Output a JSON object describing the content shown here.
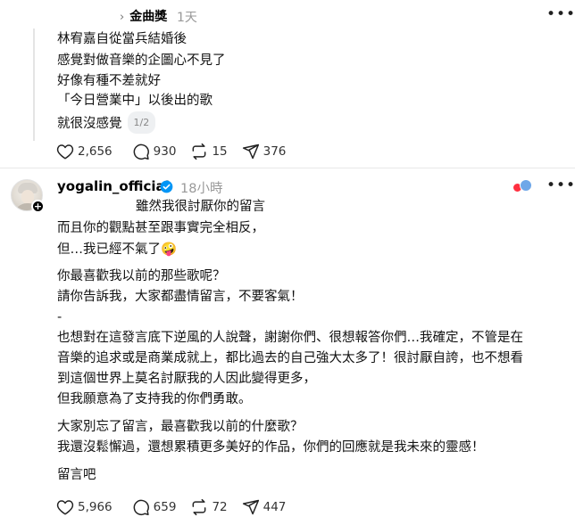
{
  "top_post": {
    "author": "金曲獎",
    "time": "1天",
    "lines": [
      "林宥嘉自從當兵結婚後",
      "感覺對做音樂的企圖心不見了",
      "好像有種不差就好",
      "「今日營業中」以後出的歌",
      "就很沒感覺"
    ],
    "pager": "1/2",
    "likes": "2,656",
    "comments": "930",
    "reposts": "15",
    "shares": "376"
  },
  "main_post": {
    "username": "yogalin_official",
    "time": "18小時",
    "lines": [
      "雖然我很討厭你的留言",
      "而且你的觀點甚至跟事實完全相反，",
      "但…我已經不氣了",
      "你最喜歡我以前的那些歌呢？",
      "請你告訴我，大家都盡情留言，不要客氣！",
      "-",
      "也想對在這發言底下逆風的人說聲，謝謝你們、很想報答你們…我確定，不管是在",
      "音樂的追求或是商業成就上，都比過去的自己強大太多了！很討厭自誇，也不想看",
      "到這個世界上莫名討厭我的人因此變得更多，",
      "但我願意為了支持我的你們勇敢。",
      "大家別忘了留言，最喜歡我以前的什麼歌？",
      "我還沒鬆懈過，還想累積更多美好的作品，你們的回應就是我未來的靈感！",
      "留言吧"
    ],
    "emoji": "🤪",
    "likes": "5,966",
    "comments": "659",
    "reposts": "72",
    "shares": "447"
  },
  "icons": {
    "more": "more-horizontal-icon",
    "like": "heart-icon",
    "comment": "comment-icon",
    "repost": "repost-icon",
    "share": "share-icon",
    "verified": "verified-badge-icon",
    "follow": "plus-icon"
  },
  "colors": {
    "verified": "#0095f6",
    "muted": "#999999",
    "thread_line": "#e4e4e4"
  }
}
